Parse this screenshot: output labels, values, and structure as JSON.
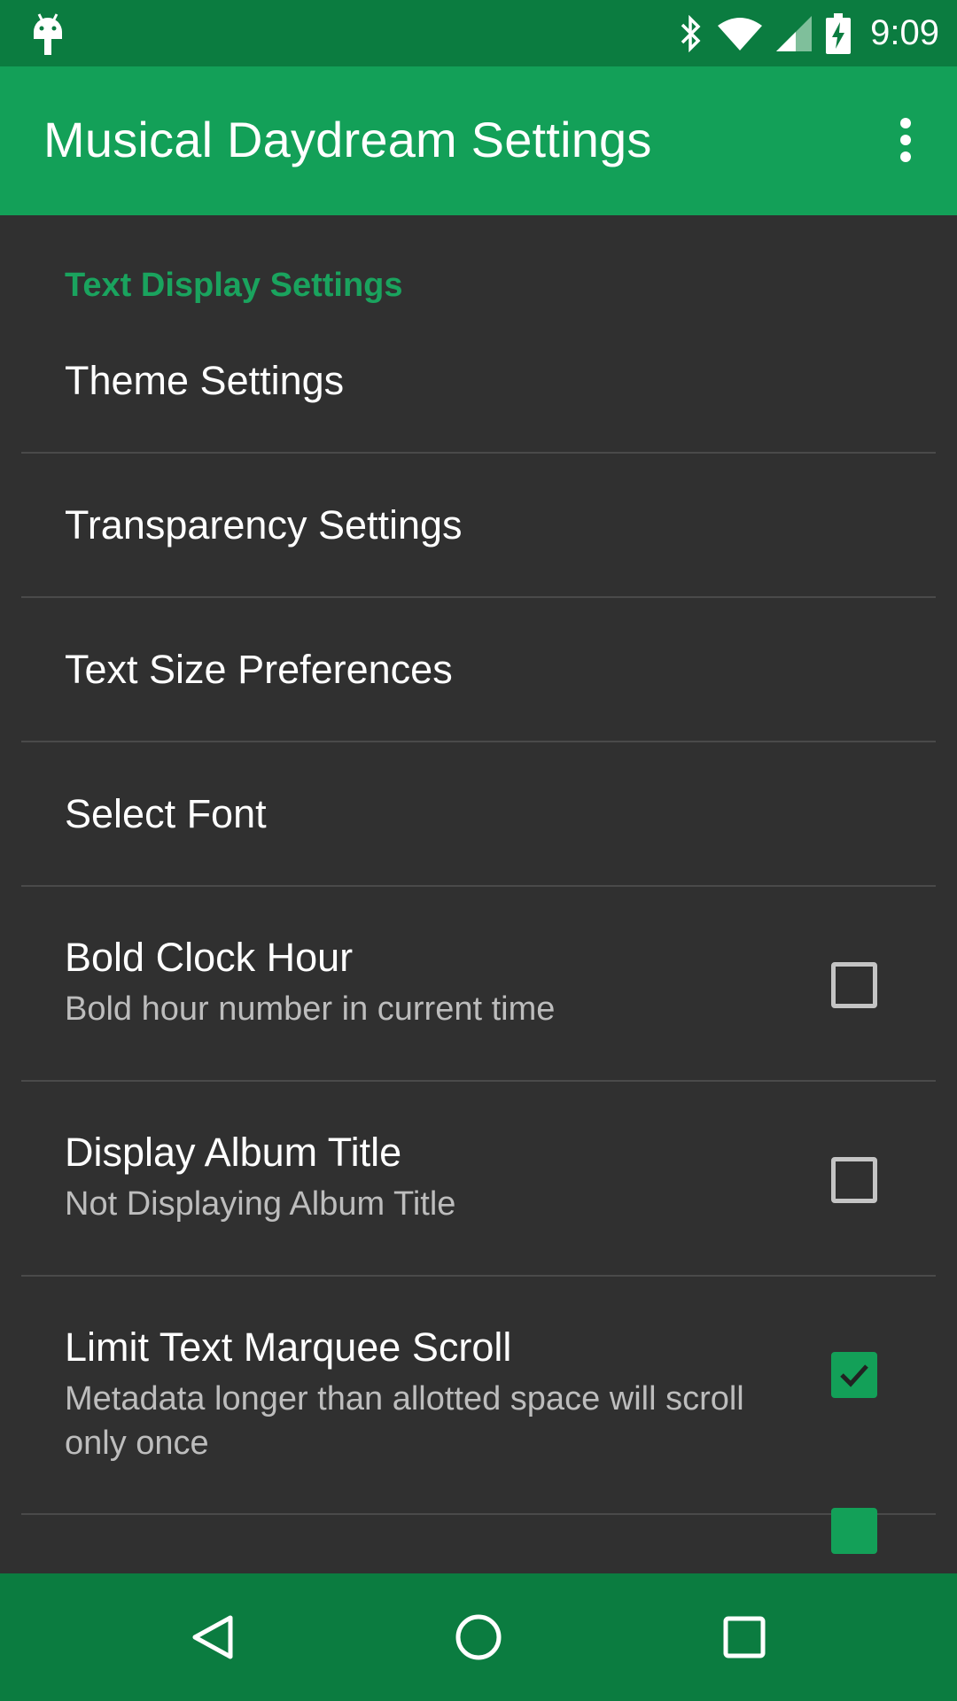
{
  "status_bar": {
    "time": "9:09",
    "icons": [
      "android-icon",
      "bluetooth-icon",
      "wifi-icon",
      "cell-signal-icon",
      "battery-charging-icon"
    ]
  },
  "app_bar": {
    "title": "Musical Daydream Settings",
    "menu_icon": "overflow-menu-icon"
  },
  "section": {
    "header": "Text Display Settings"
  },
  "preferences": [
    {
      "title": "Theme Settings"
    },
    {
      "title": "Transparency Settings"
    },
    {
      "title": "Text Size Preferences"
    },
    {
      "title": "Select Font"
    },
    {
      "title": "Bold Clock Hour",
      "summary": "Bold hour number in current time",
      "checked": false
    },
    {
      "title": "Display Album Title",
      "summary": "Not Displaying Album Title",
      "checked": false
    },
    {
      "title": "Limit Text Marquee Scroll",
      "summary": "Metadata longer than allotted space will scroll only once",
      "checked": true
    }
  ],
  "nav_bar": {
    "icons": [
      "back-icon",
      "home-icon",
      "recents-icon"
    ]
  },
  "colors": {
    "status_bar": "#0b7c40",
    "app_bar": "#13a058",
    "accent": "#1aa35e",
    "background": "#303030"
  }
}
